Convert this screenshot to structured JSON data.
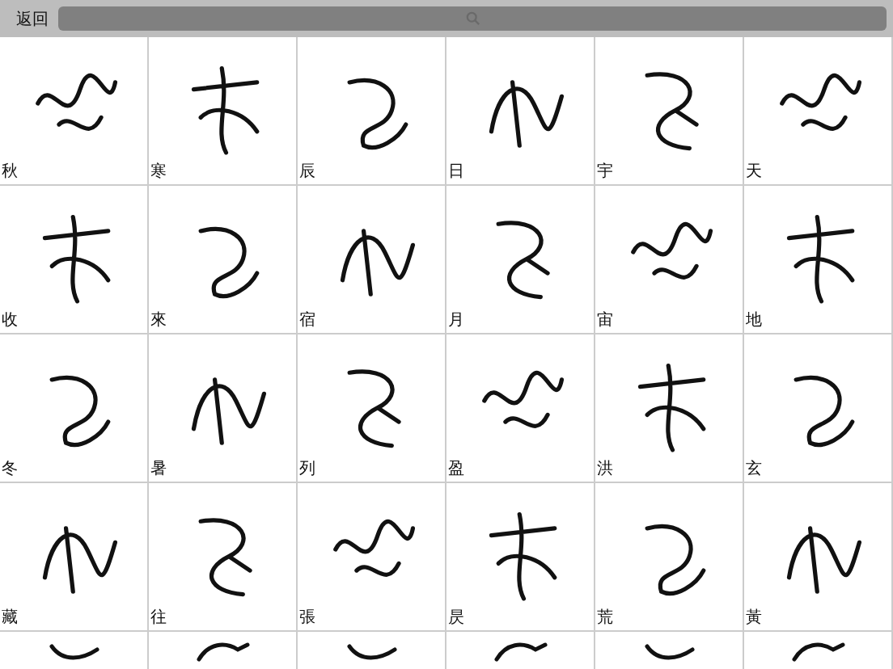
{
  "toolbar": {
    "back_button": "返回"
  },
  "cells": [
    {
      "kind": "labeled",
      "label": "秋"
    },
    {
      "kind": "labeled",
      "label": "寒"
    },
    {
      "kind": "labeled",
      "label": "辰"
    },
    {
      "kind": "labeled",
      "label": "日"
    },
    {
      "kind": "labeled",
      "label": "宇"
    },
    {
      "kind": "labeled",
      "label": "天"
    },
    {
      "kind": "labeled",
      "label": "收"
    },
    {
      "kind": "labeled",
      "label": "來"
    },
    {
      "kind": "labeled",
      "label": "宿"
    },
    {
      "kind": "labeled",
      "label": "月"
    },
    {
      "kind": "labeled",
      "label": "宙"
    },
    {
      "kind": "labeled",
      "label": "地"
    },
    {
      "kind": "labeled",
      "label": "冬"
    },
    {
      "kind": "labeled",
      "label": "暑"
    },
    {
      "kind": "labeled",
      "label": "列"
    },
    {
      "kind": "labeled",
      "label": "盈"
    },
    {
      "kind": "labeled",
      "label": "洪"
    },
    {
      "kind": "labeled",
      "label": "玄"
    },
    {
      "kind": "labeled",
      "label": "藏"
    },
    {
      "kind": "labeled",
      "label": "往"
    },
    {
      "kind": "labeled",
      "label": "張"
    },
    {
      "kind": "labeled",
      "label": "昃"
    },
    {
      "kind": "labeled",
      "label": "荒"
    },
    {
      "kind": "labeled",
      "label": "黃"
    },
    {
      "kind": "unlabeled"
    },
    {
      "kind": "unlabeled"
    },
    {
      "kind": "unlabeled"
    },
    {
      "kind": "unlabeled"
    },
    {
      "kind": "unlabeled"
    },
    {
      "kind": "unlabeled"
    }
  ]
}
